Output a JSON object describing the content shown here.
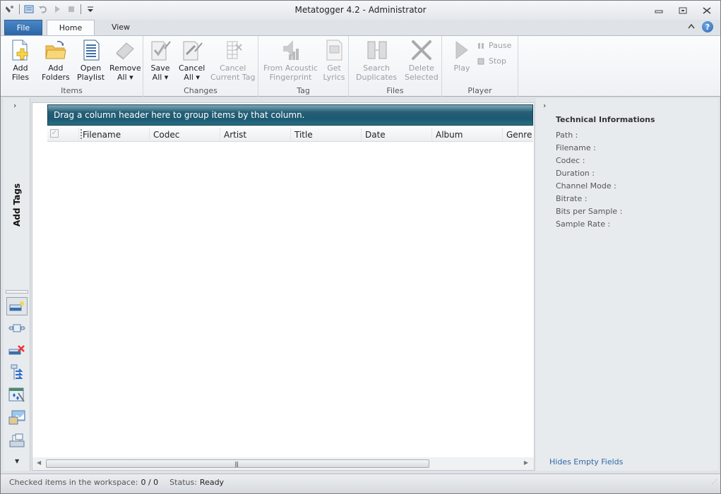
{
  "window": {
    "title": "Metatogger 4.2 - Administrator"
  },
  "quick_access": [
    {
      "icon": "app-icon"
    },
    {
      "icon": "workspace-icon"
    },
    {
      "icon": "undo-icon"
    },
    {
      "icon": "play-icon"
    },
    {
      "icon": "stop-icon"
    },
    {
      "icon": "customize-dropdown-icon"
    }
  ],
  "tabs": {
    "file": "File",
    "home": "Home",
    "view": "View"
  },
  "ribbon": {
    "groups": [
      {
        "label": "Items",
        "buttons": [
          {
            "line1": "Add",
            "line2": "Files",
            "enabled": true
          },
          {
            "line1": "Add",
            "line2": "Folders",
            "enabled": true
          },
          {
            "line1": "Open",
            "line2": "Playlist",
            "enabled": true
          },
          {
            "line1": "Remove",
            "line2": "All ▾",
            "enabled": true
          }
        ]
      },
      {
        "label": "Changes",
        "buttons": [
          {
            "line1": "Save",
            "line2": "All ▾",
            "enabled": true
          },
          {
            "line1": "Cancel",
            "line2": "All ▾",
            "enabled": true
          },
          {
            "line1": "Cancel",
            "line2": "Current Tag",
            "enabled": false
          }
        ]
      },
      {
        "label": "Tag",
        "buttons": [
          {
            "line1": "From Acoustic",
            "line2": "Fingerprint",
            "enabled": false
          },
          {
            "line1": "Get",
            "line2": "Lyrics",
            "enabled": false
          }
        ]
      },
      {
        "label": "Files",
        "buttons": [
          {
            "line1": "Search",
            "line2": "Duplicates",
            "enabled": false
          },
          {
            "line1": "Delete",
            "line2": "Selected",
            "enabled": false
          }
        ]
      },
      {
        "label": "Player",
        "buttons": [
          {
            "line1": "Play",
            "line2": "",
            "enabled": false
          }
        ],
        "small_buttons": [
          {
            "label": "Pause",
            "enabled": false
          },
          {
            "label": "Stop",
            "enabled": false
          }
        ]
      }
    ]
  },
  "left_panel": {
    "title": "Add Tags",
    "tools": [
      {
        "icon": "add-tag-tool-icon",
        "selected": true
      },
      {
        "icon": "tag-editor-tool-icon",
        "selected": false
      },
      {
        "icon": "remove-tag-tool-icon",
        "selected": false
      },
      {
        "icon": "tag-transfer-tool-icon",
        "selected": false
      },
      {
        "icon": "script-tool-icon",
        "selected": false
      },
      {
        "icon": "cover-art-tool-icon",
        "selected": false
      },
      {
        "icon": "storage-tool-icon",
        "selected": false
      }
    ]
  },
  "grid": {
    "group_hint": "Drag a column header here to group items by that column.",
    "columns": [
      "Filename",
      "Codec",
      "Artist",
      "Title",
      "Date",
      "Album",
      "Genre"
    ],
    "rows": []
  },
  "right_panel": {
    "title": "Technical Informations",
    "fields": [
      "Path :",
      "Filename :",
      "Codec :",
      "Duration :",
      "Channel Mode :",
      "Bitrate :",
      "Bits per Sample :",
      "Sample Rate :"
    ],
    "hide_link": "Hides Empty Fields"
  },
  "status": {
    "checked_label": "Checked items in the workspace:",
    "checked_value": "0 / 0",
    "status_label": "Status:",
    "status_value": "Ready"
  }
}
